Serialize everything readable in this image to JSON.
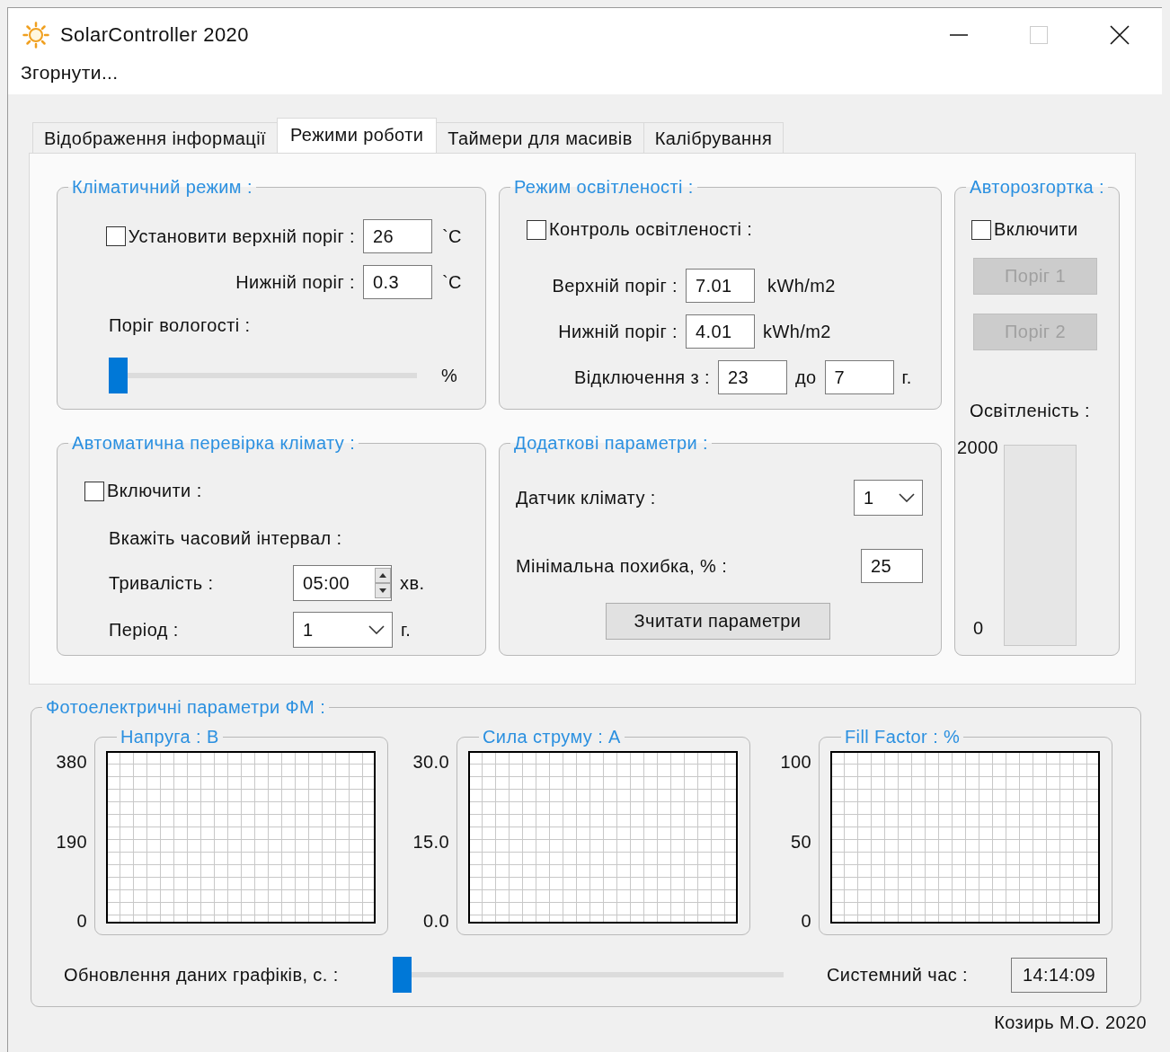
{
  "window": {
    "title": "SolarController 2020"
  },
  "menu": [
    {
      "label": "Згорнути..."
    }
  ],
  "tabs": [
    {
      "label": "Відображення інформації",
      "selected": false
    },
    {
      "label": "Режими роботи",
      "selected": true
    },
    {
      "label": "Таймери для масивів",
      "selected": false
    },
    {
      "label": "Калібрування",
      "selected": false
    }
  ],
  "climate": {
    "title": "Кліматичний режим :",
    "upper": {
      "label": "Установити верхній поріг :",
      "checked": false,
      "value": "26",
      "unit": "`C"
    },
    "lower": {
      "label": "Нижній поріг :",
      "value": "0.3",
      "unit": "`C"
    },
    "humidity": {
      "label": "Поріг вологості :",
      "level": 0,
      "unit": "%"
    }
  },
  "light": {
    "title": "Режим освітленості :",
    "control": {
      "label": "Контроль освітленості :",
      "checked": false
    },
    "upper": {
      "label": "Верхній поріг :",
      "value": "7.01",
      "unit": "kWh/m2"
    },
    "lower": {
      "label": "Нижній поріг :",
      "value": "4.01",
      "unit": "kWh/m2"
    },
    "off": {
      "label": "Відключення з :",
      "from": "23",
      "to_label": "до",
      "to": "7",
      "unit": "г."
    }
  },
  "auto_deploy": {
    "title": "Авторозгортка :",
    "enable": {
      "label": "Включити",
      "checked": false
    },
    "buttons": [
      {
        "label": "Поріг 1",
        "disabled": true
      },
      {
        "label": "Поріг 2",
        "disabled": true
      }
    ],
    "meter": {
      "label": "Освітленість :",
      "max": "2000",
      "min": "0",
      "level": 0
    }
  },
  "auto_check": {
    "title": "Автоматична перевірка клімату :",
    "enable": {
      "label": "Включити :",
      "checked": false
    },
    "hint": "Вкажіть часовий інтервал :",
    "duration": {
      "label": "Тривалість :",
      "value": "05:00",
      "unit": "хв."
    },
    "period": {
      "label": "Період :",
      "value": "1",
      "unit": "г."
    }
  },
  "extra": {
    "title": "Додаткові параметри :",
    "sensor": {
      "label": "Датчик клімату :",
      "value": "1"
    },
    "error": {
      "label": "Мінімальна похибка, % :",
      "value": "25"
    },
    "button": {
      "label": "Зчитати параметри",
      "disabled": false
    }
  },
  "pv": {
    "title": "Фотоелектричні параметри  ФМ :",
    "charts": [
      {
        "title": "Напруга : В",
        "ticks": [
          "380",
          "190",
          "0"
        ]
      },
      {
        "title": "Сила струму : А",
        "ticks": [
          "30.0",
          "15.0",
          "0.0"
        ]
      },
      {
        "title": "Fill Factor : %",
        "ticks": [
          "100",
          "50",
          "0"
        ]
      }
    ],
    "update": {
      "label": "Обновлення даних графіків, с. :",
      "level": 0
    },
    "clock": {
      "label": "Системний час :",
      "value": "14:14:09"
    }
  },
  "footer": "Козирь М.О. 2020"
}
